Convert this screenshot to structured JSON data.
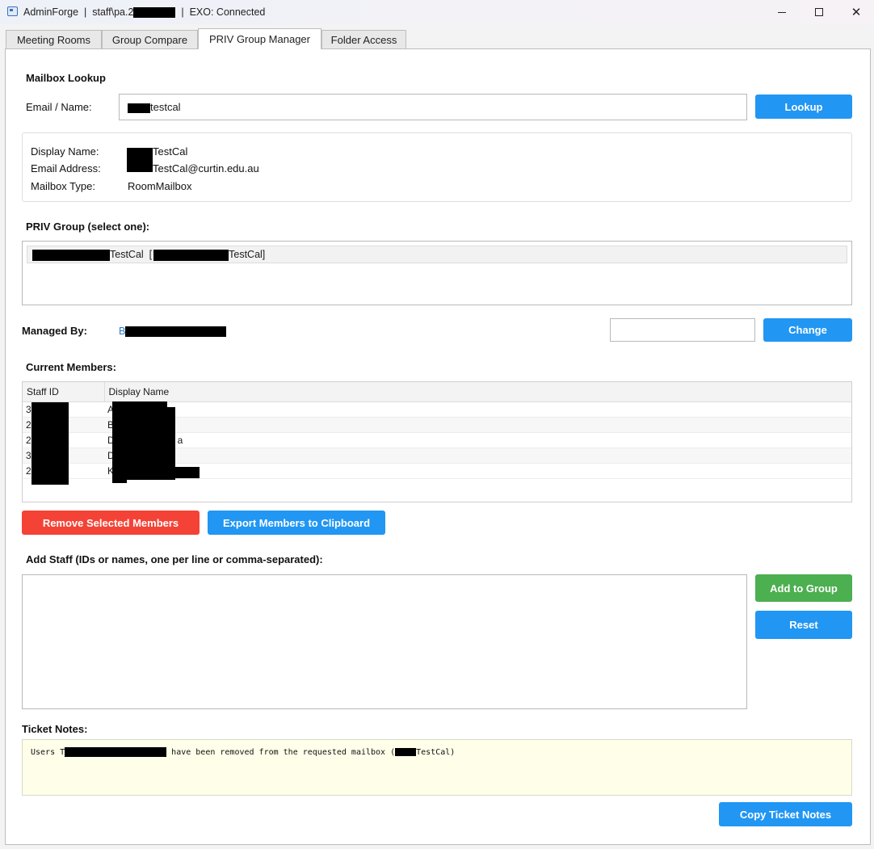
{
  "window": {
    "app_name": "AdminForge",
    "user_prefix": "staff\\pa.2",
    "status": "EXO: Connected"
  },
  "tabs": [
    {
      "label": "Meeting Rooms"
    },
    {
      "label": "Group Compare"
    },
    {
      "label": "PRIV Group Manager"
    },
    {
      "label": "Folder Access"
    }
  ],
  "lookup": {
    "heading": "Mailbox Lookup",
    "email_label": "Email / Name:",
    "email_value_suffix": "testcal",
    "lookup_button": "Lookup"
  },
  "mailbox": {
    "display_name_label": "Display Name:",
    "display_name_suffix": "TestCal",
    "email_label": "Email Address:",
    "email_suffix": "TestCal@curtin.edu.au",
    "type_label": "Mailbox Type:",
    "type_value": "RoomMailbox"
  },
  "priv_group": {
    "heading": "PRIV Group (select one):",
    "item_suffix_1": "TestCal",
    "item_bracket_open": "[",
    "item_suffix_2": "TestCal]"
  },
  "managed_by": {
    "label": "Managed By:",
    "value_prefix": "B",
    "change_button": "Change"
  },
  "members": {
    "heading": "Current Members:",
    "columns": [
      "Staff ID",
      "Display Name"
    ],
    "rows": [
      {
        "id": "3",
        "name": "A"
      },
      {
        "id": "2",
        "name": "B"
      },
      {
        "id": "2",
        "name": "D",
        "name_tail": "a"
      },
      {
        "id": "3",
        "name": "D"
      },
      {
        "id": "2",
        "name": "K"
      }
    ],
    "remove_button": "Remove Selected Members",
    "export_button": "Export Members to Clipboard"
  },
  "add_staff": {
    "heading": "Add Staff (IDs or names, one per line or comma-separated):",
    "value": "",
    "add_button": "Add to Group",
    "reset_button": "Reset"
  },
  "ticket": {
    "heading": "Ticket Notes:",
    "text_start": "Users T",
    "text_middle": " have been removed from the requested mailbox (",
    "text_end": "TestCal)",
    "copy_button": "Copy Ticket Notes"
  },
  "colors": {
    "primary": "#2196f3",
    "danger": "#f44336",
    "success": "#4caf50",
    "link": "#2b7bc4",
    "notes_bg": "#fefee9"
  },
  "icons": {
    "app": "app-window-icon",
    "minimize": "minimize-icon",
    "maximize": "maximize-icon",
    "close": "close-icon"
  }
}
